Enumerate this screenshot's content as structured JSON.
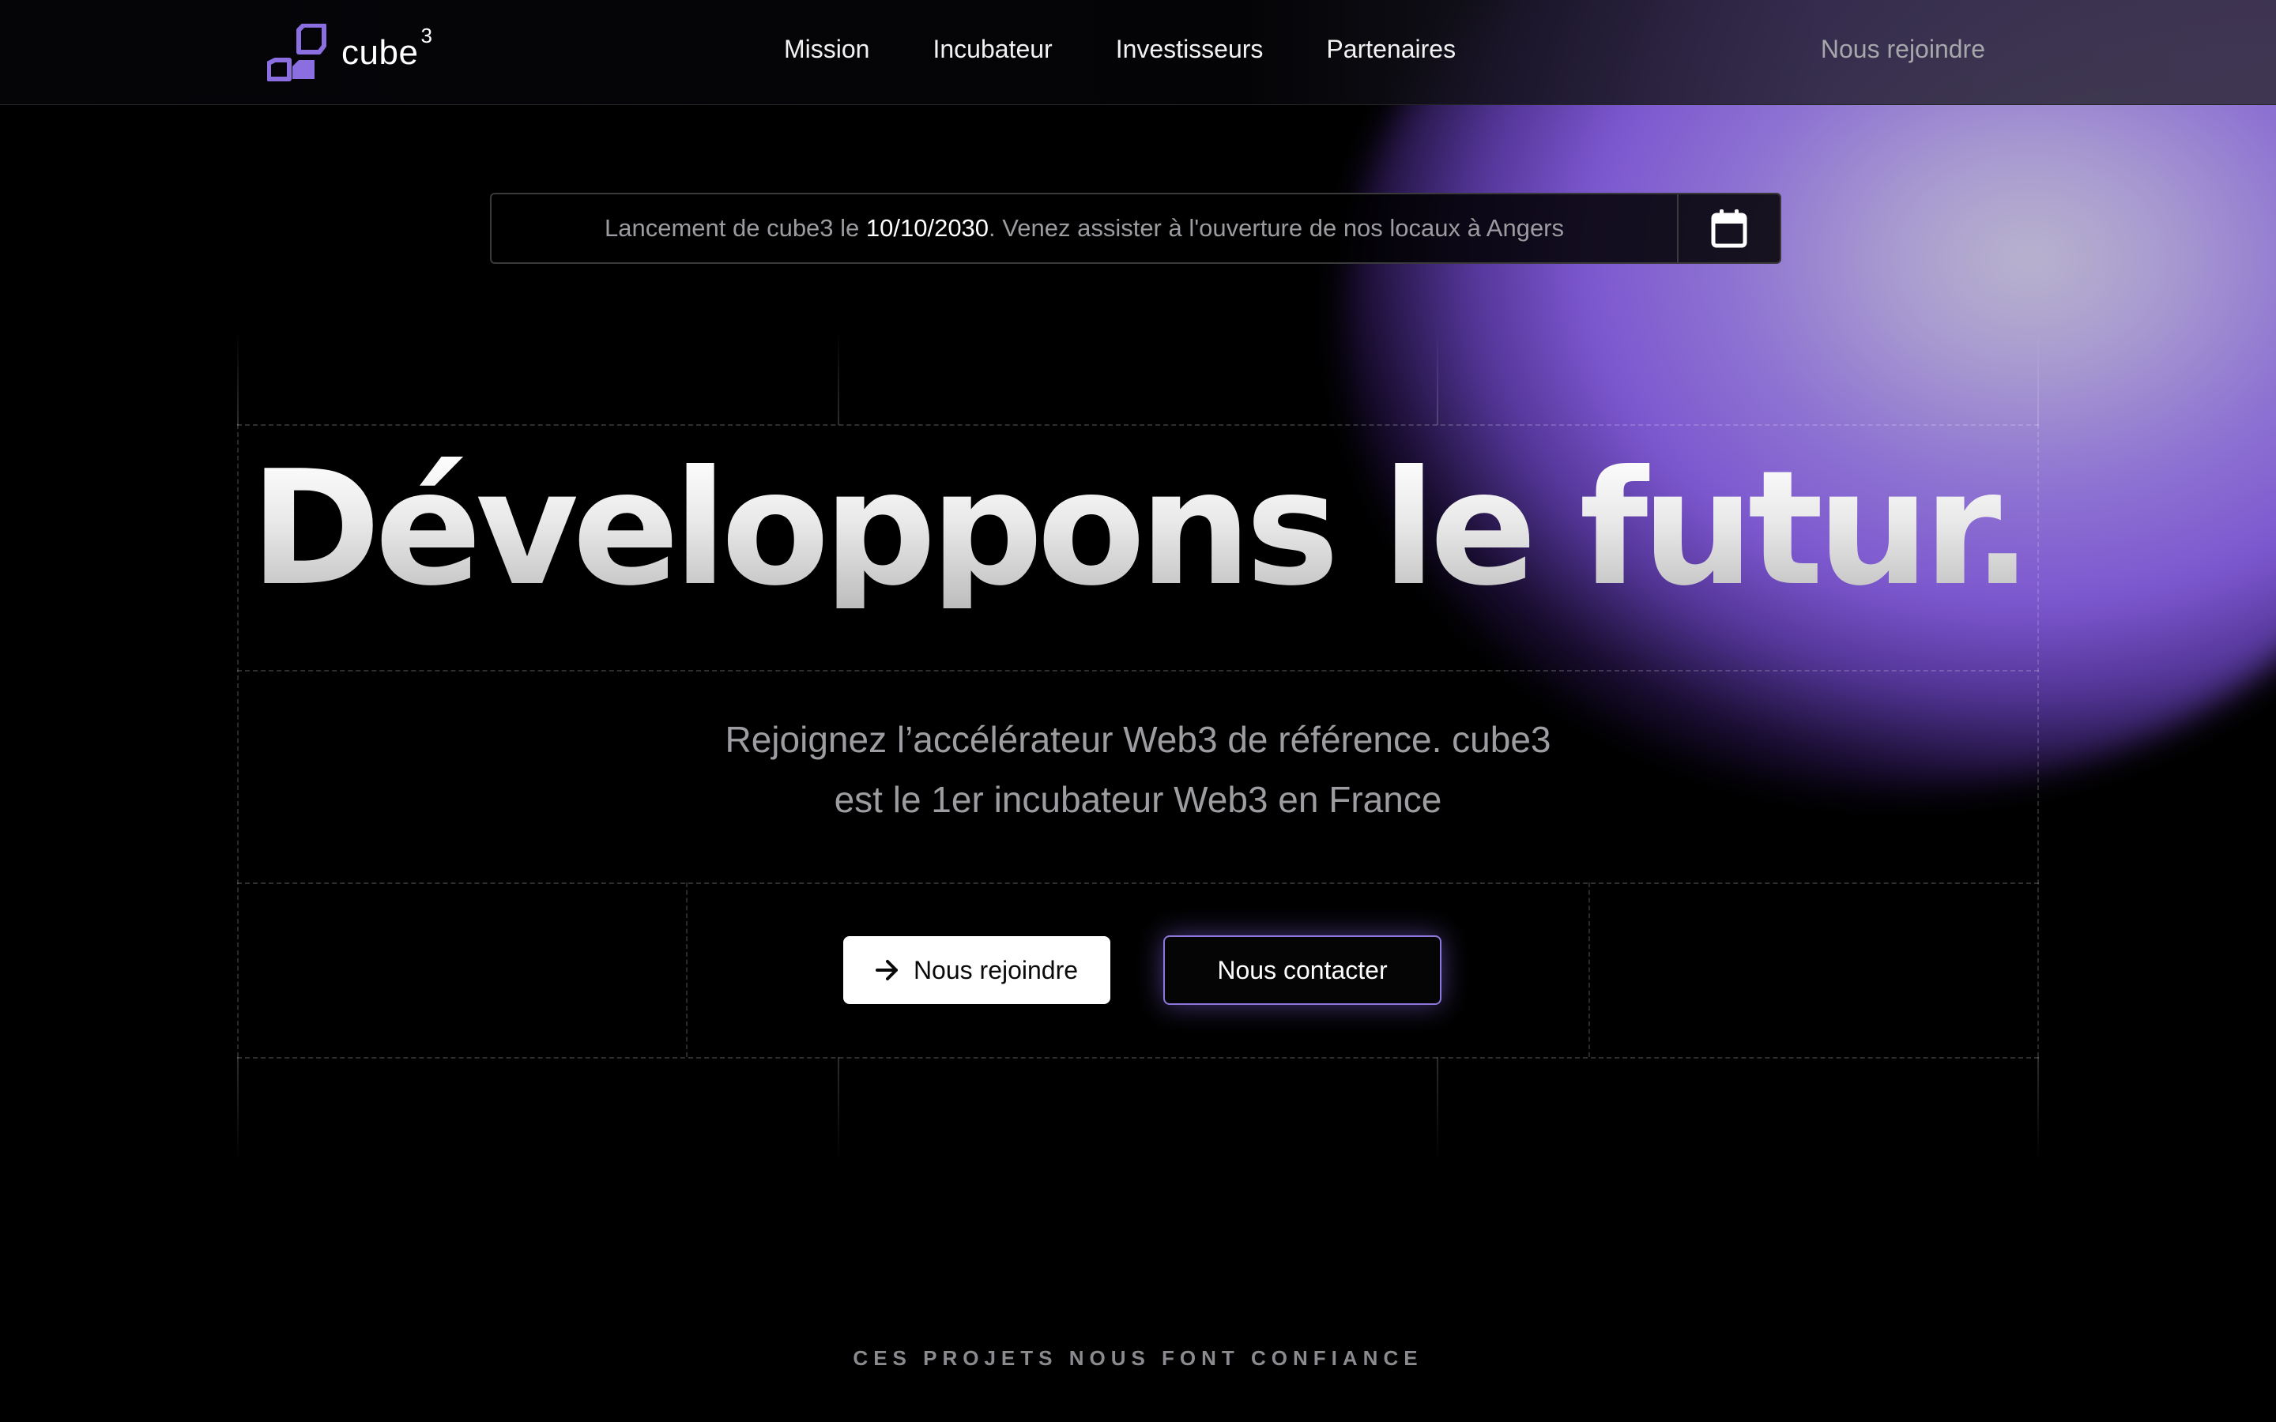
{
  "brand": {
    "name": "cube",
    "superscript": "3",
    "accent_color": "#8b6ee0"
  },
  "nav": {
    "links": [
      "Mission",
      "Incubateur",
      "Investisseurs",
      "Partenaires"
    ],
    "join_label": "Nous rejoindre"
  },
  "announcement": {
    "prefix": "Lancement de cube3 le ",
    "date": "10/10/2030",
    "suffix": ". Venez assister à l'ouverture de nos locaux à Angers",
    "icon": "calendar-icon"
  },
  "hero": {
    "headline": "Développons le futur.",
    "subtitle_line1": "Rejoignez l’accélérateur Web3 de référence. cube3",
    "subtitle_line2": "est le 1er incubateur Web3 en France",
    "primary_button": "Nous rejoindre",
    "primary_icon": "arrow-right-icon",
    "secondary_button": "Nous contacter"
  },
  "trust": {
    "heading": "CES PROJETS NOUS FONT CONFIANCE"
  }
}
